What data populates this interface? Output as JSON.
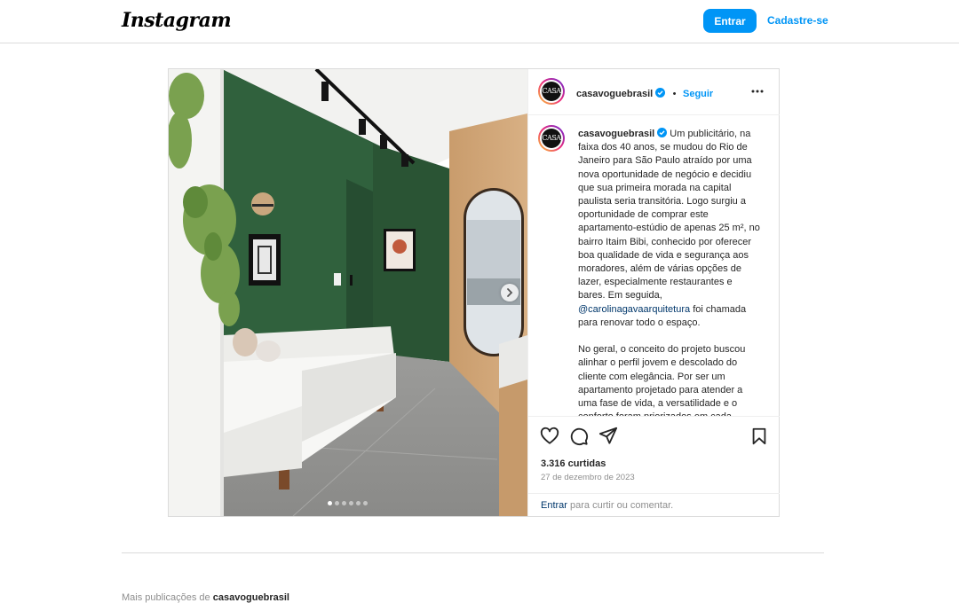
{
  "header": {
    "logo": "Instagram",
    "login_label": "Entrar",
    "signup_label": "Cadastre-se"
  },
  "post": {
    "username": "casavoguebrasil",
    "avatar_text": "CASA",
    "follow_label": "Seguir",
    "separator": "•",
    "caption_user": "casavoguebrasil",
    "caption_part1": " Um publicitário, na faixa dos 40 anos, se mudou do Rio de Janeiro para São Paulo atraído por uma nova oportunidade de negócio e decidiu que sua primeira morada na capital paulista seria transitória. Logo surgiu a oportunidade de comprar este apartamento-estúdio de apenas 25 m², no bairro Itaim Bibi, conhecido por oferecer boa qualidade de vida e segurança aos moradores, além de várias opções de lazer, especialmente restaurantes e bares. Em seguida, ",
    "caption_mention": "@carolinagavaarquitetura",
    "caption_part2": " foi chamada para renovar todo o espaço.\n\nNo geral, o conceito do projeto buscou alinhar o perfil jovem e descolado do cliente com elegância. Por ser um apartamento projetado para atender a uma fase de vida, a versatilidade e o conforto foram priorizados em cada cantinho.",
    "likes": "3.316 curtidas",
    "date": "27 de dezembro de 2023",
    "comment_login": "Entrar",
    "comment_rest": " para curtir ou comentar.",
    "carousel": {
      "count": 6,
      "active": 0
    }
  },
  "footer": {
    "more_label": "Mais publicações de ",
    "more_user": "casavoguebrasil"
  },
  "colors": {
    "accent": "#0095f6",
    "wall_green": "#2e5a3a",
    "text": "#262626",
    "muted": "#8e8e8e"
  },
  "icons": [
    "heart-icon",
    "comment-icon",
    "share-icon",
    "bookmark-icon",
    "more-options-icon",
    "verified-badge-icon",
    "chevron-right-icon"
  ]
}
